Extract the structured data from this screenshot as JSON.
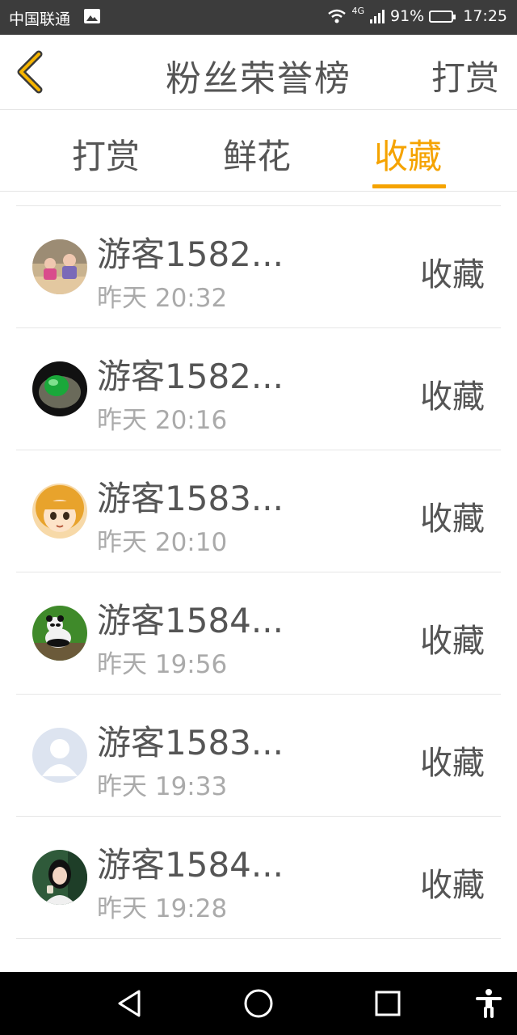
{
  "status_bar": {
    "carrier": "中国联通",
    "network": "4G",
    "battery": "91%",
    "time": "17:25"
  },
  "header": {
    "title": "粉丝荣誉榜",
    "action_label": "打赏"
  },
  "tabs": [
    {
      "label": "打赏",
      "active": false
    },
    {
      "label": "鲜花",
      "active": false
    },
    {
      "label": "收藏",
      "active": true
    }
  ],
  "colors": {
    "accent": "#f5a300",
    "text": "#555555",
    "subtext": "#aaaaaa"
  },
  "entries": [
    {
      "name": "游客1582...",
      "time": "昨天 20:32",
      "type": "收藏",
      "avatar": "kids-photo"
    },
    {
      "name": "游客1582...",
      "time": "昨天 20:16",
      "type": "收藏",
      "avatar": "jade-ring-photo"
    },
    {
      "name": "游客1583...",
      "time": "昨天 20:10",
      "type": "收藏",
      "avatar": "cartoon-girl"
    },
    {
      "name": "游客1584...",
      "time": "昨天 19:56",
      "type": "收藏",
      "avatar": "panda-photo"
    },
    {
      "name": "游客1583...",
      "time": "昨天 19:33",
      "type": "收藏",
      "avatar": "default-avatar"
    },
    {
      "name": "游客1584...",
      "time": "昨天 19:28",
      "type": "收藏",
      "avatar": "woman-photo"
    }
  ]
}
